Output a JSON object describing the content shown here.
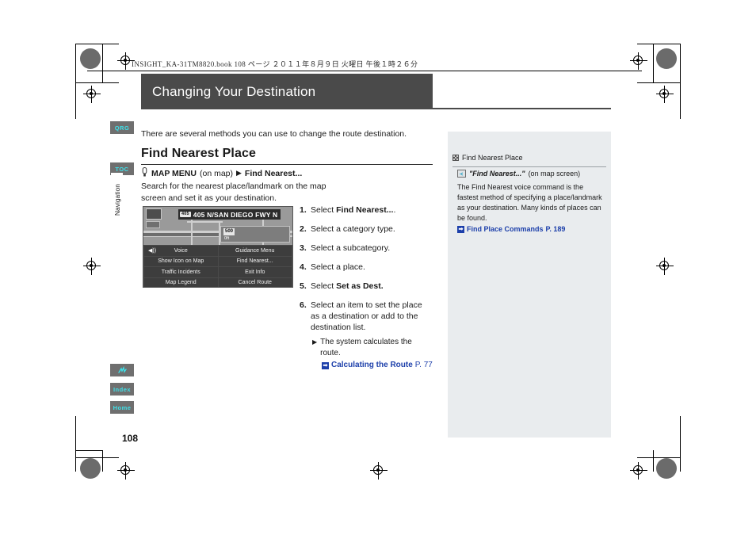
{
  "print_header": {
    "file_line": "INSIGHT_KA-31TM8820.book   108 ページ   ２０１１年８月９日   火曜日   午後１時２６分"
  },
  "chapter": {
    "title": "Changing Your Destination"
  },
  "side_tabs": [
    {
      "label": "QRG",
      "name": "qrg"
    },
    {
      "label": "TOC",
      "name": "toc"
    },
    {
      "label": "Navigation",
      "name": "navigation"
    },
    {
      "label": "",
      "name": "voice-command",
      "icon": "voice-command-icon"
    },
    {
      "label": "Index",
      "name": "index"
    },
    {
      "label": "Home",
      "name": "home"
    }
  ],
  "main": {
    "intro": "There are several methods you can use to change the route destination.",
    "heading": "Find Nearest Place",
    "breadcrumb": {
      "press_icon": "finger-press-icon",
      "first": "MAP MENU",
      "first_note": "(on map)",
      "arrow": "▶",
      "second": "Find Nearest..."
    },
    "description": "Search for the nearest place/landmark on the map screen and set it as your destination.",
    "steps": [
      {
        "num": "1.",
        "prefix": "Select ",
        "bold": "Find Nearest...",
        "suffix": "."
      },
      {
        "num": "2.",
        "prefix": "Select a category type.",
        "bold": "",
        "suffix": ""
      },
      {
        "num": "3.",
        "prefix": "Select a subcategory.",
        "bold": "",
        "suffix": ""
      },
      {
        "num": "4.",
        "prefix": "Select a place.",
        "bold": "",
        "suffix": ""
      },
      {
        "num": "5.",
        "prefix": "Select ",
        "bold": "Set as Dest.",
        "suffix": ""
      },
      {
        "num": "6.",
        "prefix": "Select an item to set the place as a destination or add to the destination list.",
        "bold": "",
        "suffix": ""
      }
    ],
    "note": {
      "arrow": "▶",
      "text": "The system calculates the route.",
      "xref_icon": "➡",
      "xref_label": "Calculating the Route",
      "xref_page": "P. 77"
    }
  },
  "nav_screen": {
    "shield": "405",
    "street": "405 N/SAN DIEGO FWY N",
    "scale_value": "500",
    "scale_unit": "ft",
    "scale_sub": "0ft",
    "speaker_icon": "speaker-icon",
    "buttons": [
      "Voice",
      "Guidance Menu",
      "Show Icon on Map",
      "Find Nearest...",
      "Traffic Incidents",
      "Exit Info",
      "Map Legend",
      "Cancel Route"
    ]
  },
  "side_panel": {
    "heading_icon": "grid-icon",
    "heading": "Find Nearest Place",
    "voice_icon": "voice-command-icon",
    "voice_command": "\"Find Nearest...\"",
    "voice_context": "(on map screen)",
    "body": "The Find Nearest voice command is the fastest method of specifying a place/landmark as your destination. Many kinds of places can be found.",
    "xref_icon": "➡",
    "xref_label": "Find Place Commands",
    "xref_page": "P. 189"
  },
  "page_number": "108",
  "colors": {
    "title_bar": "#4a4a4a",
    "tab_bg": "#6f6f6f",
    "tab_text": "#3ee0e8",
    "xref_blue": "#1c3faa",
    "panel_bg": "#e9ecee"
  }
}
